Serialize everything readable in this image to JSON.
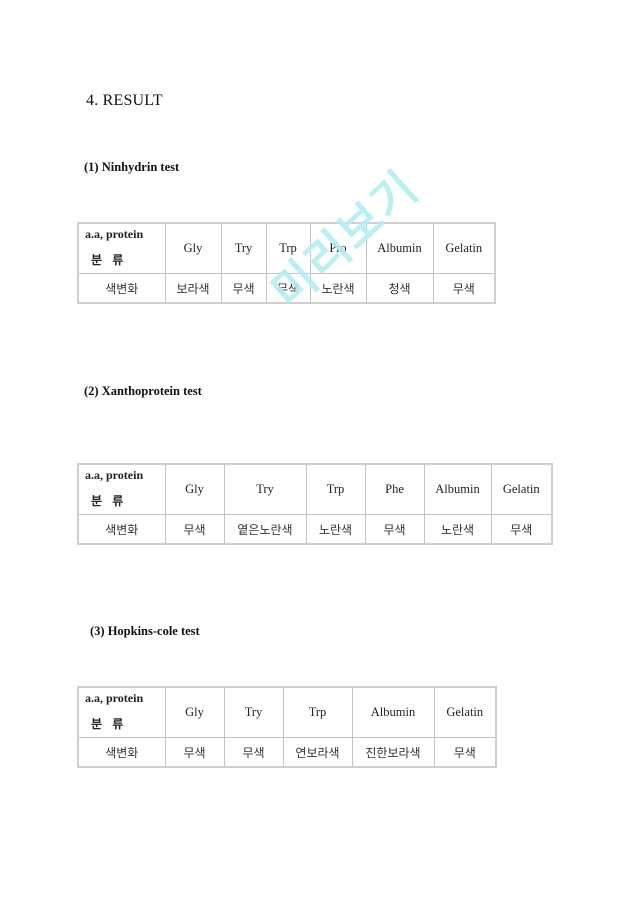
{
  "document": {
    "heading": "4. RESULT",
    "watermark": "미리보기",
    "watermark_color": "#b4eef0",
    "corner_label_top": "a.a, protein",
    "corner_label_bottom": "분 류",
    "row_label": "색변화",
    "tests": [
      {
        "title": "(1) Ninhydrin test",
        "columns": [
          "Gly",
          "Try",
          "Trp",
          "Pro",
          "Albumin",
          "Gelatin"
        ],
        "results": [
          "보라색",
          "무색",
          "무색",
          "노란색",
          "청색",
          "무색"
        ]
      },
      {
        "title": "(2) Xanthoprotein test",
        "columns": [
          "Gly",
          "Try",
          "Trp",
          "Phe",
          "Albumin",
          "Gelatin"
        ],
        "results": [
          "무색",
          "옅은노란색",
          "노란색",
          "무색",
          "노란색",
          "무색"
        ]
      },
      {
        "title": "(3) Hopkins-cole test",
        "columns": [
          "Gly",
          "Try",
          "Trp",
          "Albumin",
          "Gelatin"
        ],
        "results": [
          "무색",
          "무색",
          "연보라색",
          "진한보라색",
          "무색"
        ]
      }
    ]
  }
}
